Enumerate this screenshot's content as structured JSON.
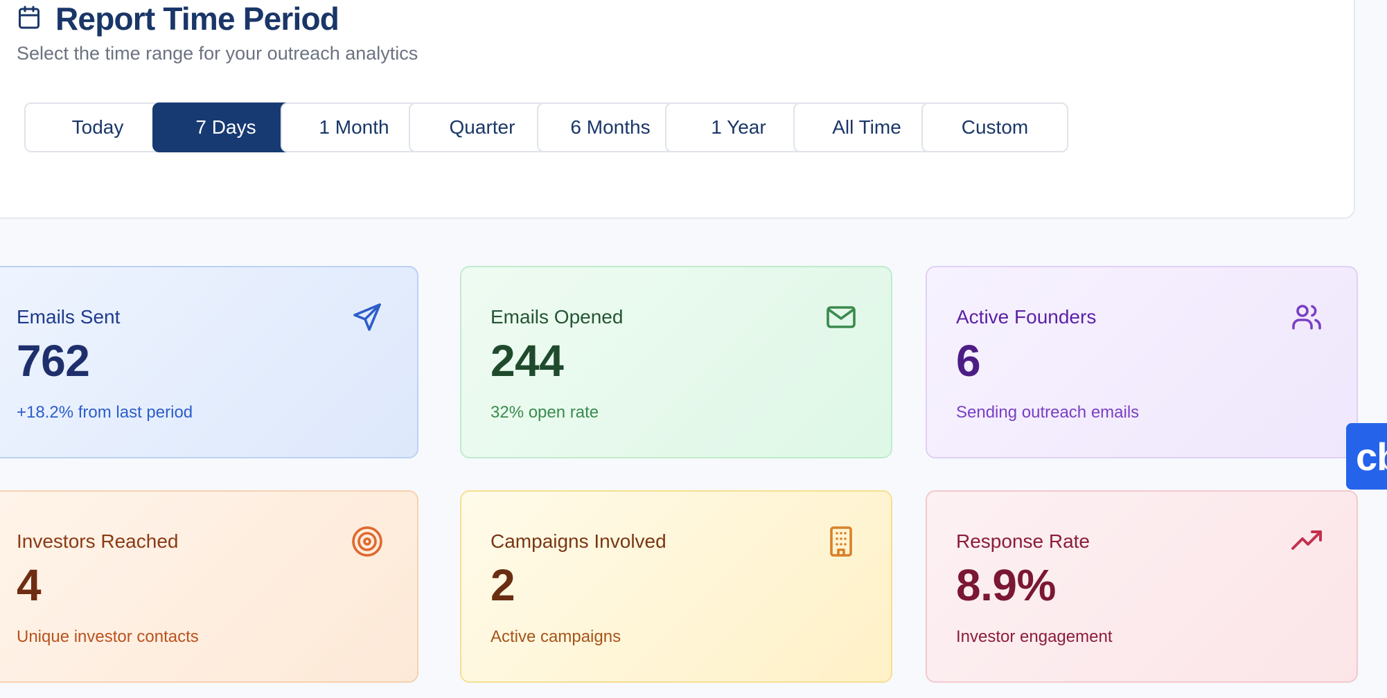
{
  "header": {
    "title": "Report Time Period",
    "subtitle": "Select the time range for your outreach analytics",
    "icon": "calendar-icon"
  },
  "periods": {
    "selected": "7 Days",
    "options": [
      "Today",
      "7 Days",
      "1 Month",
      "Quarter",
      "6 Months",
      "1 Year",
      "All Time",
      "Custom"
    ]
  },
  "stats": [
    {
      "label": "Emails Sent",
      "value": "762",
      "sub": "+18.2% from last period",
      "icon": "send-icon",
      "color": "#2c5dc9"
    },
    {
      "label": "Emails Opened",
      "value": "244",
      "sub": "32% open rate",
      "icon": "mail-icon",
      "color": "#3a8a4e"
    },
    {
      "label": "Active Founders",
      "value": "6",
      "sub": "Sending outreach emails",
      "icon": "users-icon",
      "color": "#7a3fc4"
    },
    {
      "label": "Investors Reached",
      "value": "4",
      "sub": "Unique investor contacts",
      "icon": "target-icon",
      "color": "#e0682d"
    },
    {
      "label": "Campaigns Involved",
      "value": "2",
      "sub": "Active campaigns",
      "icon": "building-icon",
      "color": "#d9812a"
    },
    {
      "label": "Response Rate",
      "value": "8.9%",
      "sub": "Investor engagement",
      "icon": "trending-up-icon",
      "color": "#c4304f"
    }
  ],
  "chat_widget": {
    "label": "cb"
  }
}
